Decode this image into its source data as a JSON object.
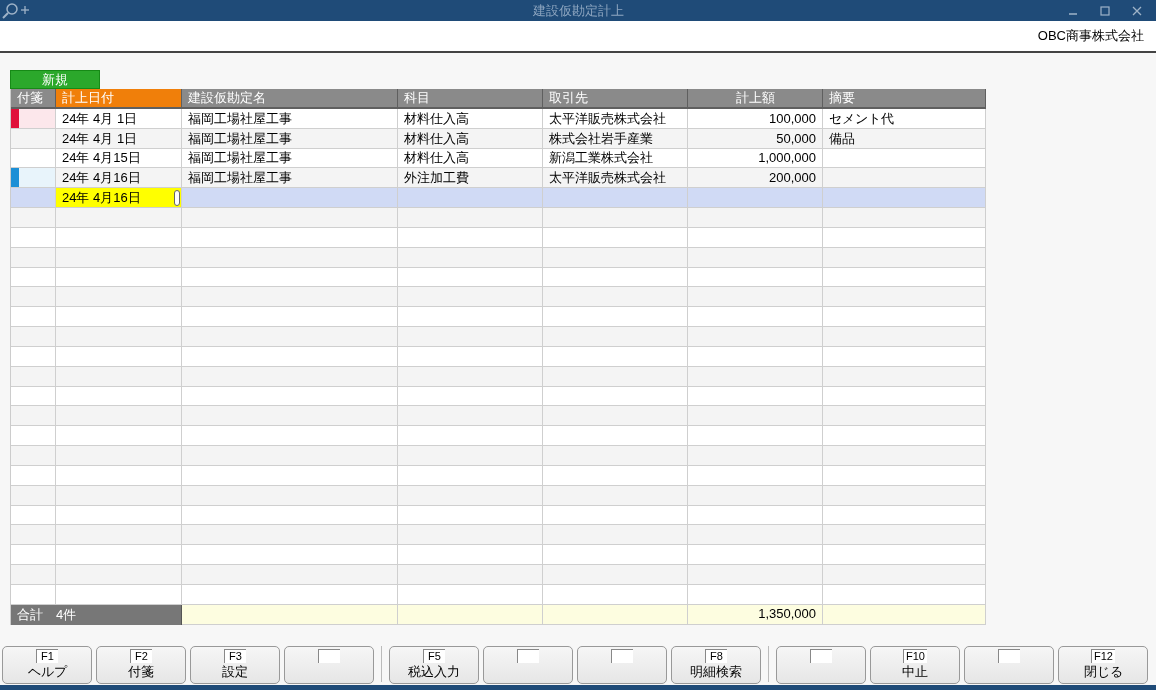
{
  "window": {
    "title": "建設仮勘定計上"
  },
  "company": "OBC商事株式会社",
  "new_tab": {
    "label": "新規",
    "selected": true
  },
  "table": {
    "columns": [
      {
        "label": "付箋",
        "kind": "tag",
        "selected": false
      },
      {
        "label": "計上日付",
        "kind": "date",
        "selected": true
      },
      {
        "label": "建設仮勘定名",
        "kind": "text",
        "selected": false
      },
      {
        "label": "科目",
        "kind": "text",
        "selected": false
      },
      {
        "label": "取引先",
        "kind": "text",
        "selected": false
      },
      {
        "label": "計上額",
        "kind": "amount",
        "selected": false
      },
      {
        "label": "摘要",
        "kind": "text",
        "selected": false
      }
    ],
    "rows": [
      {
        "color": "#e0103a",
        "cells": [
          "",
          "24年  4月  1日",
          "福岡工場社屋工事",
          "材料仕入高",
          "太平洋販売株式会社",
          "100,000",
          "セメント代"
        ],
        "selected": false,
        "editing": false
      },
      {
        "cells": [
          "",
          "24年  4月  1日",
          "福岡工場社屋工事",
          "材料仕入高",
          "株式会社岩手産業",
          "50,000",
          "備品"
        ],
        "selected": false,
        "editing": false
      },
      {
        "cells": [
          "",
          "24年  4月15日",
          "福岡工場社屋工事",
          "材料仕入高",
          "新潟工業株式会社",
          "1,000,000",
          ""
        ],
        "selected": false,
        "editing": false
      },
      {
        "color": "#1c8fd6",
        "cells": [
          "",
          "24年  4月16日",
          "福岡工場社屋工事",
          "外注加工費",
          "太平洋販売株式会社",
          "200,000",
          ""
        ],
        "selected": false,
        "editing": false
      },
      {
        "cells": [
          "",
          "24年  4月16日",
          "",
          "",
          "",
          "",
          ""
        ],
        "selected": true,
        "editing": true
      }
    ],
    "total": {
      "label": "合計　4件",
      "amount": "1,350,000"
    }
  },
  "function_keys": [
    [
      {
        "kind": "key",
        "key": "F1",
        "label": "ヘルプ"
      },
      {
        "kind": "key",
        "key": "F2",
        "label": "付箋"
      },
      {
        "kind": "key",
        "key": "F3",
        "label": "設定"
      },
      {
        "kind": "blank"
      }
    ],
    [
      {
        "kind": "key",
        "key": "F5",
        "label": "税込入力"
      },
      {
        "kind": "blank"
      },
      {
        "kind": "blank"
      },
      {
        "kind": "key",
        "key": "F8",
        "label": "明細検索"
      }
    ],
    [
      {
        "kind": "blank"
      },
      {
        "kind": "key",
        "key": "F10",
        "label": "中止"
      },
      {
        "kind": "blank"
      },
      {
        "kind": "key",
        "key": "F12",
        "label": "閉じる"
      }
    ]
  ]
}
